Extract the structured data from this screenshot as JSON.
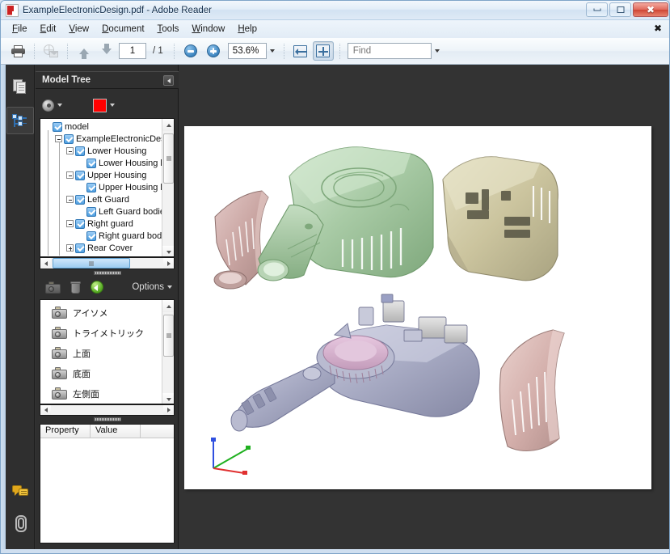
{
  "window": {
    "title": "ExampleElectronicDesign.pdf - Adobe Reader",
    "app_icon": "pdf-document-icon",
    "buttons": {
      "minimize": "minimize-icon",
      "restore": "restore-icon",
      "close": "✖"
    }
  },
  "menu": {
    "items": [
      {
        "label": "File",
        "accel": "F"
      },
      {
        "label": "Edit",
        "accel": "E"
      },
      {
        "label": "View",
        "accel": "V"
      },
      {
        "label": "Document",
        "accel": "D"
      },
      {
        "label": "Tools",
        "accel": "T"
      },
      {
        "label": "Window",
        "accel": "W"
      },
      {
        "label": "Help",
        "accel": "H"
      }
    ],
    "close_label": "✖"
  },
  "toolbar": {
    "print": "print-icon",
    "email": "email-icon",
    "previous_page": "arrow-up-icon",
    "next_page": "arrow-down-icon",
    "page_number": "1",
    "page_total": "/ 1",
    "zoom_out": "zoom-out-icon",
    "zoom_in": "zoom-in-icon",
    "zoom_level": "53.6%",
    "fit_width": "fit-width-icon",
    "fit_page": "fit-page-icon",
    "find_placeholder": "Find",
    "find_value": ""
  },
  "rail": {
    "items": [
      {
        "name": "pages-panel-button",
        "icon": "pages-icon",
        "active": false
      },
      {
        "name": "model-tree-panel-button",
        "icon": "model-tree-icon",
        "active": true
      }
    ],
    "bottom_items": [
      {
        "name": "comments-panel-button",
        "icon": "comments-icon"
      },
      {
        "name": "attachments-panel-button",
        "icon": "paperclip-icon"
      }
    ]
  },
  "panel": {
    "title": "Model Tree",
    "collapse_icon": "collapse-panel-icon",
    "toolbar": {
      "gear": "gear-icon",
      "gear_caret": "chevron-down-icon",
      "color_swatch": "#ff0000",
      "color_caret": "chevron-down-icon"
    },
    "tree": [
      {
        "label": "model",
        "depth": 0,
        "expander": "none",
        "checked": true
      },
      {
        "label": "ExampleElectronicDesign",
        "depth": 1,
        "expander": "minus",
        "checked": true
      },
      {
        "label": "Lower Housing",
        "depth": 2,
        "expander": "minus",
        "checked": true
      },
      {
        "label": "Lower Housing bo",
        "depth": 3,
        "expander": "none",
        "checked": true
      },
      {
        "label": "Upper Housing",
        "depth": 2,
        "expander": "minus",
        "checked": true
      },
      {
        "label": "Upper Housing bo",
        "depth": 3,
        "expander": "none",
        "checked": true
      },
      {
        "label": "Left Guard",
        "depth": 2,
        "expander": "minus",
        "checked": true
      },
      {
        "label": "Left Guard bodies",
        "depth": 3,
        "expander": "none",
        "checked": true
      },
      {
        "label": "Right guard",
        "depth": 2,
        "expander": "minus",
        "checked": true
      },
      {
        "label": "Right guard bodies",
        "depth": 3,
        "expander": "none",
        "checked": true
      },
      {
        "label": "Rear Cover",
        "depth": 2,
        "expander": "plus",
        "checked": true
      }
    ],
    "views_toolbar": {
      "capture_view": "camera-icon",
      "delete_view": "trash-icon",
      "default_view": "green-arrow-icon",
      "options_label": "Options",
      "options_caret": "chevron-down-icon"
    },
    "views": [
      {
        "label": "アイソメ",
        "icon": "camera-icon"
      },
      {
        "label": "トライメトリック",
        "icon": "camera-icon"
      },
      {
        "label": "上面",
        "icon": "camera-icon"
      },
      {
        "label": "底面",
        "icon": "camera-icon"
      },
      {
        "label": "左側面",
        "icon": "camera-icon"
      }
    ],
    "properties": {
      "columns": [
        "Property",
        "Value"
      ],
      "rows": []
    }
  },
  "document": {
    "model_name": "exploded-assembly-3d-model",
    "axis_triad": {
      "x_color": "#e03030",
      "y_color": "#20b020",
      "z_color": "#3050e0"
    },
    "parts": [
      {
        "name": "upper-housing",
        "color": "#a8c9a8"
      },
      {
        "name": "rear-cover",
        "color": "#cfc9a0"
      },
      {
        "name": "left-guard",
        "color": "#c9a8a8"
      },
      {
        "name": "right-guard",
        "color": "#d2aaa8"
      },
      {
        "name": "lower-housing",
        "color": "#a9abc4"
      },
      {
        "name": "fan-rotor",
        "color": "#d8b4d2"
      }
    ]
  }
}
